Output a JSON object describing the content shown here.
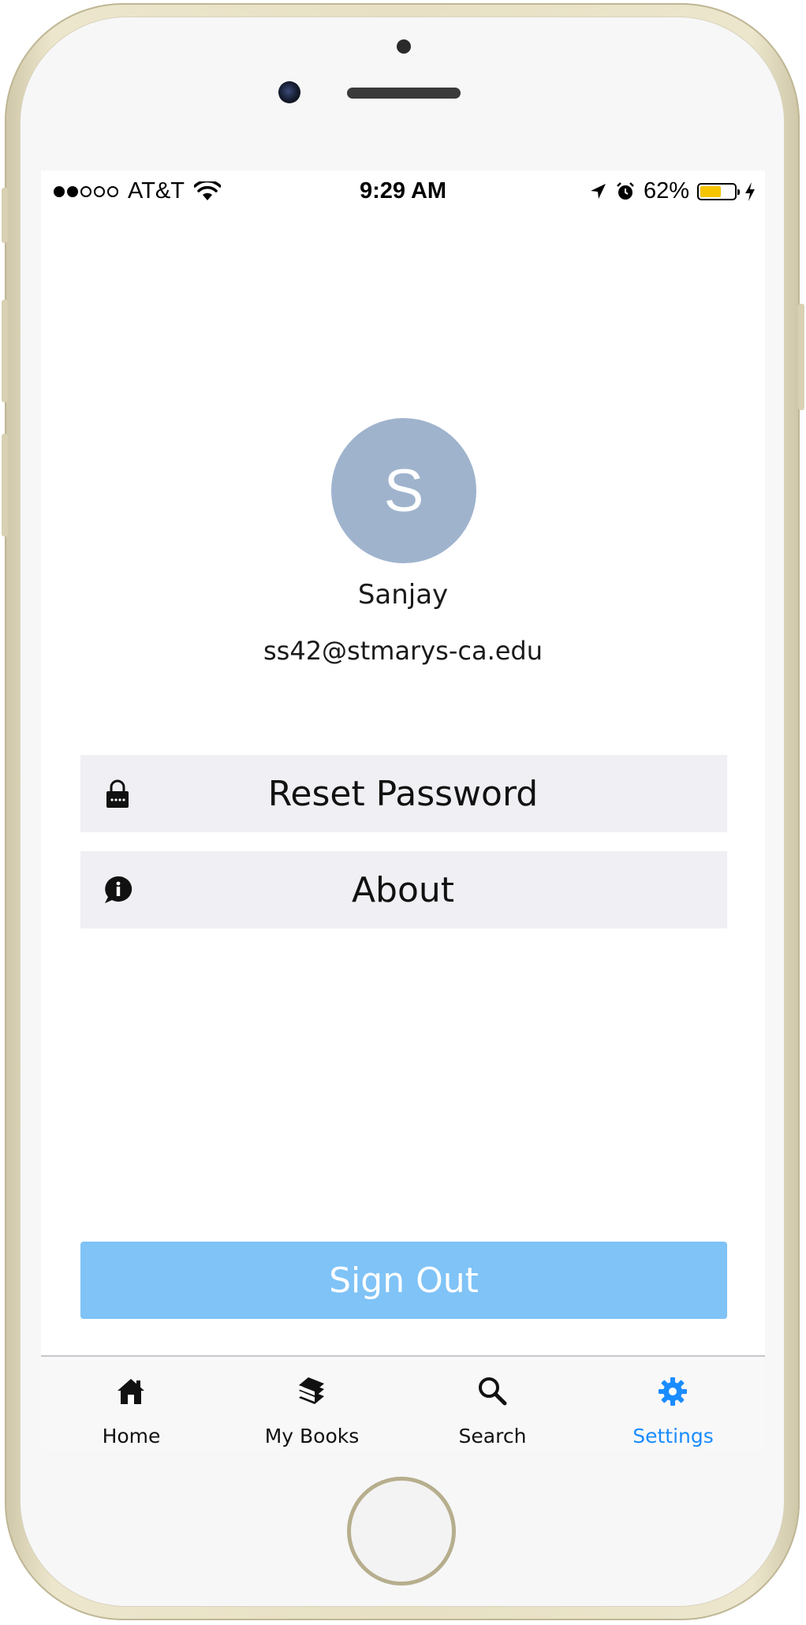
{
  "status_bar": {
    "carrier": "AT&T",
    "time": "9:29 AM",
    "battery_percent": "62%",
    "battery_level": 0.62,
    "signal_bars_filled": 2,
    "signal_bars_total": 5
  },
  "profile": {
    "avatar_initial": "S",
    "avatar_color": "#9fb3cd",
    "name": "Sanjay",
    "email": "ss42@stmarys-ca.edu"
  },
  "menu": {
    "reset_password": {
      "label": "Reset Password",
      "icon": "lock-icon"
    },
    "about": {
      "label": "About",
      "icon": "info-bubble-icon"
    }
  },
  "sign_out": {
    "label": "Sign Out",
    "color": "#7fc3f7"
  },
  "tab_bar": {
    "active_color": "#1a8cff",
    "tabs": [
      {
        "label": "Home",
        "icon": "home-icon",
        "active": false
      },
      {
        "label": "My Books",
        "icon": "books-icon",
        "active": false
      },
      {
        "label": "Search",
        "icon": "search-icon",
        "active": false
      },
      {
        "label": "Settings",
        "icon": "gear-icon",
        "active": true
      }
    ]
  }
}
